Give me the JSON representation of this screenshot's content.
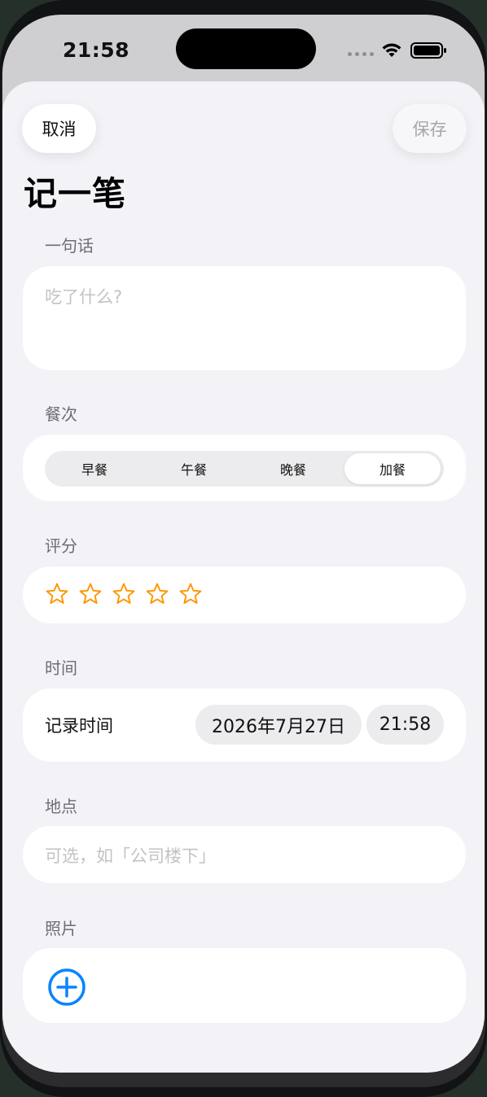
{
  "status_bar": {
    "time": "21:58",
    "icons": [
      "signal-icon",
      "wifi-icon",
      "battery-icon"
    ]
  },
  "nav": {
    "cancel_label": "取消",
    "save_label": "保存"
  },
  "page": {
    "title": "记一笔"
  },
  "note_section": {
    "label": "一句话",
    "placeholder": "吃了什么?"
  },
  "meal_section": {
    "label": "餐次",
    "options": [
      "早餐",
      "午餐",
      "晚餐",
      "加餐"
    ],
    "selected": "加餐"
  },
  "rating_section": {
    "label": "评分",
    "rating": 0,
    "max": 5,
    "star_color": "#ff9500"
  },
  "time_section": {
    "label": "时间",
    "row_label": "记录时间",
    "date": "2026年7月27日",
    "time": "21:58"
  },
  "location_section": {
    "label": "地点",
    "placeholder": "可选，如「公司楼下」"
  },
  "photo_section": {
    "label": "照片",
    "add_icon": "plus-circle-icon",
    "accent_color": "#0a84ff"
  }
}
